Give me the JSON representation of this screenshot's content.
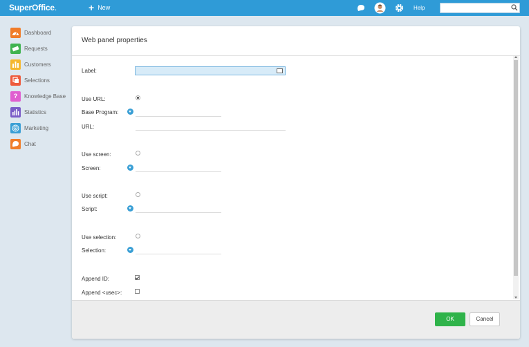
{
  "topbar": {
    "logo": "SuperOffice",
    "logo_dot": ".",
    "new_label": "New",
    "help_label": "Help",
    "search_placeholder": "",
    "icons": [
      "chat-bubble-icon",
      "user-avatar",
      "gear-icon",
      "search-icon"
    ]
  },
  "sidebar": {
    "items": [
      {
        "label": "Dashboard",
        "icon": "dashboard-icon",
        "color": "#f07c28"
      },
      {
        "label": "Requests",
        "icon": "requests-icon",
        "color": "#3fb34f"
      },
      {
        "label": "Customers",
        "icon": "customers-icon",
        "color": "#f5b82e"
      },
      {
        "label": "Selections",
        "icon": "selections-icon",
        "color": "#ee5a3c"
      },
      {
        "label": "Knowledge Base",
        "icon": "knowledge-base-icon",
        "color": "#e05fd0"
      },
      {
        "label": "Statistics",
        "icon": "statistics-icon",
        "color": "#7a5bc7"
      },
      {
        "label": "Marketing",
        "icon": "marketing-icon",
        "color": "#3a9fd5"
      },
      {
        "label": "Chat",
        "icon": "chat-icon",
        "color": "#f07c28"
      }
    ]
  },
  "dialog": {
    "title": "Web panel properties",
    "fields": {
      "label": "Label:",
      "label_value": "",
      "use_url": "Use URL:",
      "base_program": "Base Program:",
      "url": "URL:",
      "use_screen": "Use screen:",
      "screen": "Screen:",
      "use_script": "Use script:",
      "script": "Script:",
      "use_selection": "Use selection:",
      "selection": "Selection:",
      "append_id": "Append ID:",
      "append_usec": "Append <usec>:"
    },
    "state": {
      "use_url": true,
      "use_screen": false,
      "use_script": false,
      "use_selection": false,
      "append_id": true,
      "append_usec": false
    },
    "buttons": {
      "ok": "OK",
      "cancel": "Cancel"
    },
    "colors": {
      "ok": "#2fb34a",
      "accent": "#2f9bd7"
    }
  }
}
